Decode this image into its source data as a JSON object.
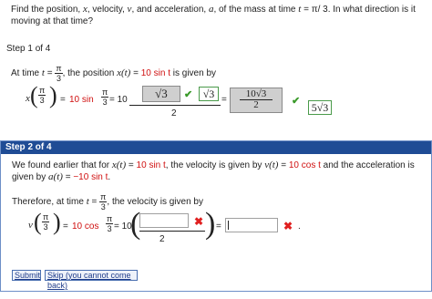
{
  "question": {
    "p1": "Find the position, ",
    "x": "x",
    "p2": ", velocity, ",
    "v": "v",
    "p3": ", and acceleration, ",
    "a": "a",
    "p4": ", of the mass at time ",
    "t": "t",
    "p5": " = π/ 3. In what direction is it moving at that time?"
  },
  "step1": {
    "label": "Step 1 of 4",
    "text_pre": "At time ",
    "t": "t",
    "eq": " = ",
    "pi": "π",
    "three": "3",
    "text_mid": ", the position ",
    "xt": "x(t)",
    "eq2": " = ",
    "red_expr": "10 sin t",
    "text_post": " is given by",
    "lhs_x": "x",
    "eq_a": "= ",
    "red_mid": "10 sin",
    "eq_b": " = 10",
    "box1": "√3",
    "denom": "2",
    "box2": "√3",
    "eq_c": "=",
    "box3_num": "10√3",
    "box3_den": "2",
    "box4": "5√3"
  },
  "step2": {
    "label": "Step 2 of 4",
    "l1a": "We found earlier that for ",
    "l1b": "x(t)",
    "l1c": " = ",
    "l1d": "10 sin t",
    "l1e": ", the velocity is given by ",
    "l1f": "v(t)",
    "l1g": " = ",
    "l1h": "10 cos t",
    "l1i": " and the acceleration is given by ",
    "l1j": "a(t)",
    "l1k": " = ",
    "l1l": "−10 sin t",
    "l1m": ".",
    "l2a": "Therefore, at time ",
    "l2b": "t",
    "l2c": " = ",
    "l2d": ", the velocity is given by",
    "lhs_v": "v",
    "eq_a": "= ",
    "red_mid": "10 cos",
    "eq_b": " = 10",
    "denom": "2",
    "eq_c": "=",
    "dot": "."
  },
  "buttons": {
    "submit": "Submit",
    "skip": "Skip (you cannot come back)"
  },
  "colors": {
    "header": "#1f4c95",
    "accent_red": "#d01010",
    "check_green": "#3a9a2a",
    "x_red": "#e02020"
  }
}
